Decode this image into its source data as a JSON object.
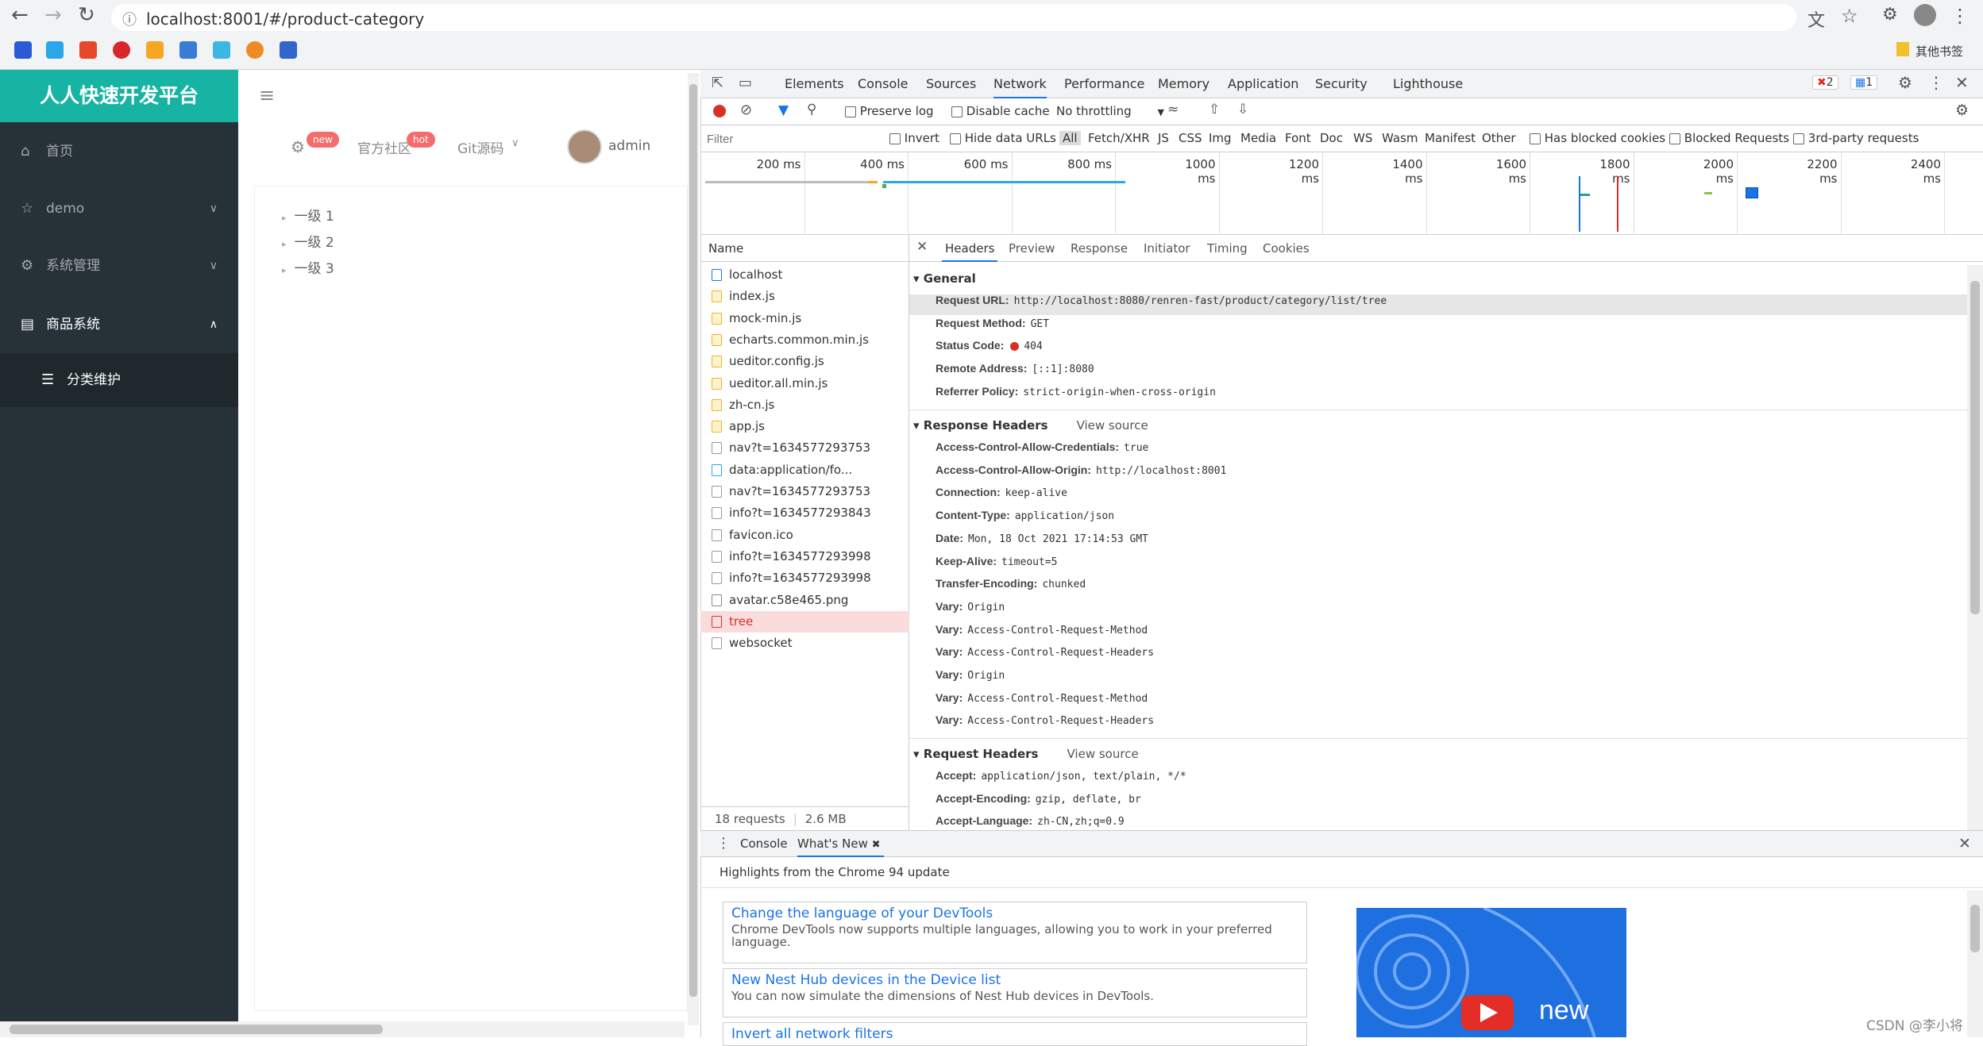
{
  "browser": {
    "url": "localhost:8001/#/product-category",
    "bookmark_folder": "其他书签"
  },
  "app": {
    "brand": "人人快速开发平台",
    "menu": [
      {
        "label": "首页"
      },
      {
        "label": "demo"
      },
      {
        "label": "系统管理"
      },
      {
        "label": "商品系统"
      }
    ],
    "submenu_active": "分类维护",
    "topnav": {
      "new_badge": "new",
      "community": "官方社区",
      "hot_badge": "hot",
      "git": "Git源码",
      "user": "admin"
    },
    "tree": [
      "一级 1",
      "一级 2",
      "一级 3"
    ]
  },
  "devtools": {
    "tabs": [
      "Elements",
      "Console",
      "Sources",
      "Network",
      "Performance",
      "Memory",
      "Application",
      "Security",
      "Lighthouse"
    ],
    "active_tab": "Network",
    "error_count": "2",
    "msg_count": "1",
    "toolbar": {
      "preserve_log": "Preserve log",
      "disable_cache": "Disable cache",
      "throttling": "No throttling"
    },
    "filter": {
      "placeholder": "Filter",
      "invert": "Invert",
      "hide_data_urls": "Hide data URLs",
      "types": [
        "All",
        "Fetch/XHR",
        "JS",
        "CSS",
        "Img",
        "Media",
        "Font",
        "Doc",
        "WS",
        "Wasm",
        "Manifest",
        "Other"
      ],
      "blocked_cookies": "Has blocked cookies",
      "blocked_requests": "Blocked Requests",
      "third_party": "3rd-party requests"
    },
    "timeline_ticks": [
      "200 ms",
      "400 ms",
      "600 ms",
      "800 ms",
      "1000 ms",
      "1200 ms",
      "1400 ms",
      "1600 ms",
      "1800 ms",
      "2000 ms",
      "2200 ms",
      "2400 ms"
    ],
    "name_header": "Name",
    "requests": [
      "localhost",
      "index.js",
      "mock-min.js",
      "echarts.common.min.js",
      "ueditor.config.js",
      "ueditor.all.min.js",
      "zh-cn.js",
      "app.js",
      "nav?t=1634577293753",
      "data:application/fo...",
      "nav?t=1634577293753",
      "info?t=1634577293843",
      "favicon.ico",
      "info?t=1634577293998",
      "info?t=1634577293998",
      "avatar.c58e465.png",
      "tree",
      "websocket"
    ],
    "footer": {
      "requests": "18 requests",
      "transferred": "2.6 MB transferred"
    },
    "detail_tabs": [
      "Headers",
      "Preview",
      "Response",
      "Initiator",
      "Timing",
      "Cookies"
    ],
    "general": {
      "title": "General",
      "rows": [
        {
          "k": "Request URL:",
          "v": "http://localhost:8080/renren-fast/product/category/list/tree"
        },
        {
          "k": "Request Method:",
          "v": "GET"
        },
        {
          "k": "Status Code:",
          "v": "404"
        },
        {
          "k": "Remote Address:",
          "v": "[::1]:8080"
        },
        {
          "k": "Referrer Policy:",
          "v": "strict-origin-when-cross-origin"
        }
      ]
    },
    "response_headers": {
      "title": "Response Headers",
      "view_source": "View source",
      "rows": [
        {
          "k": "Access-Control-Allow-Credentials:",
          "v": "true"
        },
        {
          "k": "Access-Control-Allow-Origin:",
          "v": "http://localhost:8001"
        },
        {
          "k": "Connection:",
          "v": "keep-alive"
        },
        {
          "k": "Content-Type:",
          "v": "application/json"
        },
        {
          "k": "Date:",
          "v": "Mon, 18 Oct 2021 17:14:53 GMT"
        },
        {
          "k": "Keep-Alive:",
          "v": "timeout=5"
        },
        {
          "k": "Transfer-Encoding:",
          "v": "chunked"
        },
        {
          "k": "Vary:",
          "v": "Origin"
        },
        {
          "k": "Vary:",
          "v": "Access-Control-Request-Method"
        },
        {
          "k": "Vary:",
          "v": "Access-Control-Request-Headers"
        },
        {
          "k": "Vary:",
          "v": "Origin"
        },
        {
          "k": "Vary:",
          "v": "Access-Control-Request-Method"
        },
        {
          "k": "Vary:",
          "v": "Access-Control-Request-Headers"
        }
      ]
    },
    "request_headers": {
      "title": "Request Headers",
      "view_source": "View source",
      "rows": [
        {
          "k": "Accept:",
          "v": "application/json, text/plain, */*"
        },
        {
          "k": "Accept-Encoding:",
          "v": "gzip, deflate, br"
        },
        {
          "k": "Accept-Language:",
          "v": "zh-CN,zh;q=0.9"
        }
      ]
    },
    "drawer": {
      "tabs": [
        "Console",
        "What's New"
      ],
      "highlight": "Highlights from the Chrome 94 update",
      "cards": [
        {
          "title": "Change the language of your DevTools",
          "desc": "Chrome DevTools now supports multiple languages, allowing you to work in your preferred language."
        },
        {
          "title": "New Nest Hub devices in the Device list",
          "desc": "You can now simulate the dimensions of Nest Hub devices in DevTools."
        },
        {
          "title": "Invert all network filters",
          "desc": ""
        }
      ],
      "promo_text": "new"
    }
  },
  "watermark": "CSDN @李小将"
}
